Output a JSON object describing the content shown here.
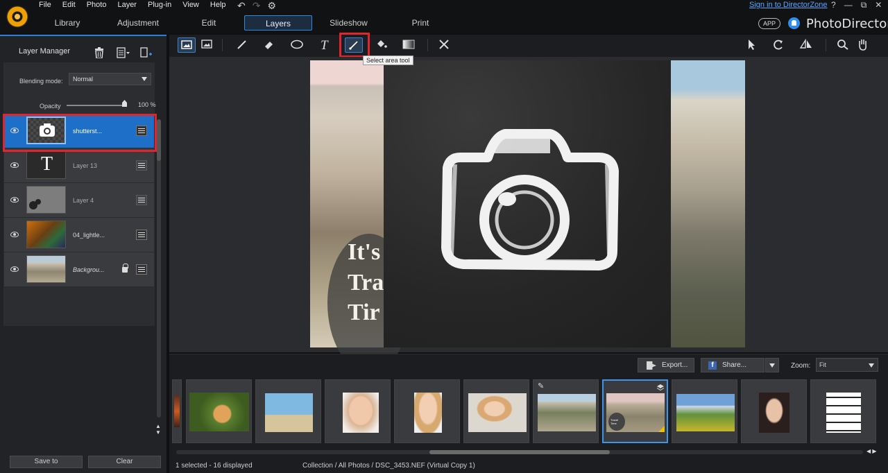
{
  "menu": [
    "File",
    "Edit",
    "Photo",
    "Layer",
    "Plug-in",
    "View",
    "Help"
  ],
  "tabs": [
    "Library",
    "Adjustment",
    "Edit",
    "Layers",
    "Slideshow",
    "Print"
  ],
  "selected_tab": "Layers",
  "signin": "Sign in to DirectorZone",
  "window_controls": [
    "?",
    "—",
    "⧉",
    "✕"
  ],
  "app_badge": "APP",
  "brand": "PhotoDirector",
  "layer_manager": {
    "title": "Layer Manager",
    "blending_label": "Blending mode:",
    "blending_value": "Normal",
    "opacity_label": "Opacity",
    "opacity_value": "100 %",
    "opacity_level": 1.0,
    "layers": [
      {
        "name": "shutterst...",
        "thumb": "camera",
        "selected": true
      },
      {
        "name": "Layer 13",
        "thumb": "text"
      },
      {
        "name": "Layer 4",
        "thumb": "gray"
      },
      {
        "name": "04_lightle...",
        "thumb": "gradient"
      },
      {
        "name": "Backgrou...",
        "thumb": "city",
        "locked": true
      }
    ],
    "layer13_glyph": "T",
    "save_to": "Save to",
    "clear": "Clear"
  },
  "tooltip": "Select area tool",
  "canvas_text": [
    "It's",
    "Tra",
    "Tir"
  ],
  "filmstrip": {
    "export": "Export...",
    "share": "Share...",
    "zoom_label": "Zoom:",
    "zoom_value": "Fit",
    "thumb_caption": "Travel Time"
  },
  "status": {
    "selection": "1 selected - 16 displayed",
    "path": "Collection / All Photos / DSC_3453.NEF (Virtual Copy 1)"
  },
  "colors": {
    "accent": "#2f8be0",
    "highlight": "#e0252e",
    "selected_layer": "#1e6fc7"
  }
}
